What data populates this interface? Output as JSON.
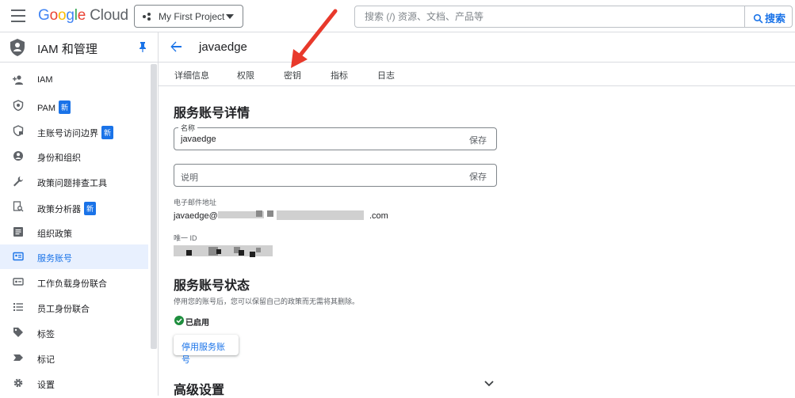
{
  "topbar": {
    "logo_google": [
      "G",
      "o",
      "o",
      "g",
      "l",
      "e"
    ],
    "logo_cloud": " Cloud",
    "project_name": "My First Project",
    "search_placeholder": "搜索 (/) 资源、文档、产品等",
    "search_button": "搜索"
  },
  "sidebar": {
    "title": "IAM 和管理",
    "items": [
      {
        "label": "IAM",
        "icon": "person-add-icon"
      },
      {
        "label": "PAM",
        "badge": "新",
        "icon": "shield-icon"
      },
      {
        "label": "主账号访问边界",
        "badge": "新",
        "icon": "shield-lock-icon"
      },
      {
        "label": "身份和组织",
        "icon": "account-circle-icon"
      },
      {
        "label": "政策问题排查工具",
        "icon": "wrench-icon"
      },
      {
        "label": "政策分析器",
        "badge": "新",
        "icon": "document-search-icon"
      },
      {
        "label": "组织政策",
        "icon": "list-box-icon"
      },
      {
        "label": "服务账号",
        "icon": "service-account-icon",
        "active": true
      },
      {
        "label": "工作负载身份联合",
        "icon": "id-card-icon"
      },
      {
        "label": "员工身份联合",
        "icon": "list-icon"
      },
      {
        "label": "标签",
        "icon": "tag-icon"
      },
      {
        "label": "标记",
        "icon": "label-icon"
      },
      {
        "label": "设置",
        "icon": "gear-icon"
      }
    ]
  },
  "header": {
    "title": "javaedge"
  },
  "tabs": [
    "详细信息",
    "权限",
    "密钥",
    "指标",
    "日志"
  ],
  "details": {
    "section_title": "服务账号详情",
    "name_label": "名称",
    "name_value": "javaedge",
    "save_label": "保存",
    "description_placeholder": "说明",
    "email_label": "电子邮件地址",
    "email_prefix": "javaedge@",
    "email_suffix": ".com",
    "unique_id_label": "唯一 ID"
  },
  "status_section": {
    "title": "服务账号状态",
    "description": "停用您的账号后，您可以保留自己的政策而无需将其删除。",
    "status": "已启用",
    "disable_button": "停用服务账号"
  },
  "advanced": {
    "title": "高级设置"
  },
  "colors": {
    "accent": "#1a73e8",
    "success": "#1e8e3e",
    "annotation_arrow": "#e8392b"
  }
}
